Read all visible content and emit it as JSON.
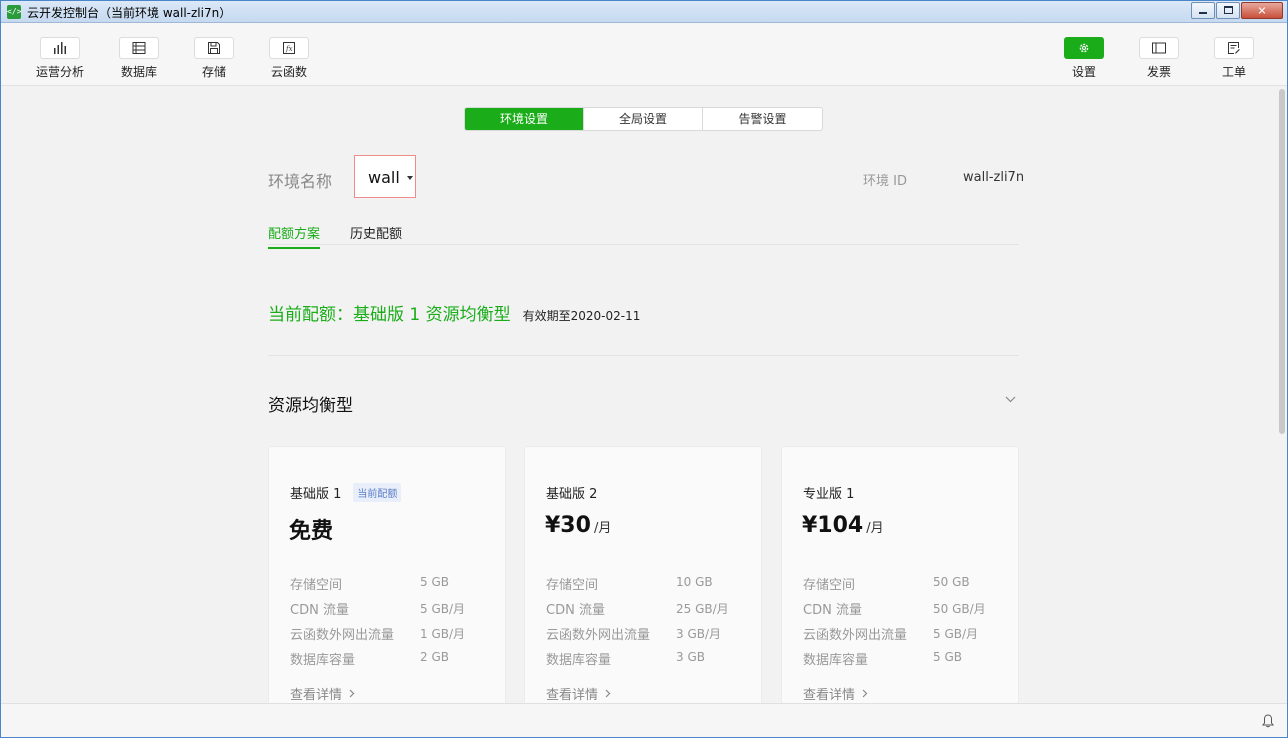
{
  "window": {
    "title": "云开发控制台（当前环境 wall-zli7n）",
    "controls": [
      "minimize",
      "maximize",
      "close"
    ]
  },
  "toolbar": {
    "left": [
      {
        "label": "运营分析",
        "icon": "bar-chart-icon"
      },
      {
        "label": "数据库",
        "icon": "database-icon"
      },
      {
        "label": "存储",
        "icon": "save-icon"
      },
      {
        "label": "云函数",
        "icon": "function-icon"
      }
    ],
    "right": [
      {
        "label": "设置",
        "icon": "gear-icon",
        "active": true
      },
      {
        "label": "发票",
        "icon": "invoice-icon"
      },
      {
        "label": "工单",
        "icon": "ticket-icon"
      }
    ]
  },
  "tabs": [
    "环境设置",
    "全局设置",
    "告警设置"
  ],
  "active_tab": "环境设置",
  "env": {
    "name_label": "环境名称",
    "name_value": "wall",
    "id_label": "环境 ID",
    "id_value": "wall-zli7n"
  },
  "subtabs": [
    "配额方案",
    "历史配额"
  ],
  "active_subtab": "配额方案",
  "current_quota": {
    "text": "当前配额：基础版 1 资源均衡型",
    "expiry": "有效期至2020-02-11"
  },
  "section": {
    "title": "资源均衡型"
  },
  "plans": [
    {
      "name": "基础版 1",
      "badge": "当前配额",
      "price": "免费",
      "unit": "",
      "specs": [
        {
          "label": "存储空间",
          "value": "5 GB"
        },
        {
          "label": "CDN 流量",
          "value": "5 GB/月"
        },
        {
          "label": "云函数外网出流量",
          "value": "1 GB/月"
        },
        {
          "label": "数据库容量",
          "value": "2 GB"
        }
      ],
      "detail": "查看详情"
    },
    {
      "name": "基础版 2",
      "badge": "",
      "price": "¥30",
      "unit": "/月",
      "specs": [
        {
          "label": "存储空间",
          "value": "10 GB"
        },
        {
          "label": "CDN 流量",
          "value": "25 GB/月"
        },
        {
          "label": "云函数外网出流量",
          "value": "3 GB/月"
        },
        {
          "label": "数据库容量",
          "value": "3 GB"
        }
      ],
      "detail": "查看详情"
    },
    {
      "name": "专业版 1",
      "badge": "",
      "price": "¥104",
      "unit": "/月",
      "specs": [
        {
          "label": "存储空间",
          "value": "50 GB"
        },
        {
          "label": "CDN 流量",
          "value": "50 GB/月"
        },
        {
          "label": "云函数外网出流量",
          "value": "5 GB/月"
        },
        {
          "label": "数据库容量",
          "value": "5 GB"
        }
      ],
      "detail": "查看详情"
    }
  ],
  "colors": {
    "accent": "#1aad19",
    "highlight_border": "#f08b8b",
    "badge_text": "#5b7fc7"
  }
}
